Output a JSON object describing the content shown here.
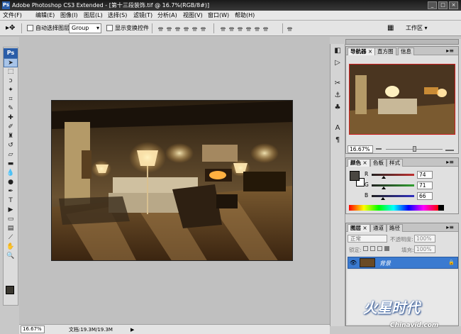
{
  "titlebar": {
    "app_title": "Adobe Photoshop CS3 Extended",
    "doc_title": "[第十三段装饰.tif @ 16.7%(RGB/8#)]",
    "min": "_",
    "max": "□",
    "close": "×"
  },
  "menubar": {
    "items": [
      "文件(F)",
      "编辑(E)",
      "图像(I)",
      "图层(L)",
      "选择(S)",
      "滤镜(T)",
      "分析(A)",
      "视图(V)",
      "窗口(W)",
      "帮助(H)"
    ]
  },
  "options": {
    "auto_select_label": "自动选择图层",
    "auto_select_value": "Group",
    "show_transform_label": "显示变换控件",
    "workspace_label": "工作区 ▾"
  },
  "status": {
    "zoom": "16.67%",
    "doc": "文档:19.3M/19.3M",
    "arrow": "▶"
  },
  "navigator": {
    "tabs": [
      "导航器",
      "直方图",
      "信息"
    ],
    "zoom": "16.67%"
  },
  "color_panel": {
    "tabs": [
      "颜色",
      "色板",
      "样式"
    ],
    "channels": [
      {
        "label": "R",
        "value": "74",
        "fraction": 0.29,
        "color": "#c03030"
      },
      {
        "label": "G",
        "value": "71",
        "fraction": 0.28,
        "color": "#30a030"
      },
      {
        "label": "B",
        "value": "66",
        "fraction": 0.26,
        "color": "#3030c0"
      }
    ],
    "fg_color": "#4a4742"
  },
  "layers_panel": {
    "tabs": [
      "图层",
      "通道",
      "路径"
    ],
    "blend_mode": "正常",
    "opacity_label": "不透明度:",
    "opacity_value": "100%",
    "lock_label": "锁定:",
    "fill_label": "填充:",
    "fill_value": "100%",
    "layer_name": "背景"
  },
  "watermark": {
    "brand": "火星时代",
    "url": "Chinavid.com"
  },
  "colors": {
    "accent": "#3a7ad0",
    "chrome": "#e4e4e4"
  }
}
